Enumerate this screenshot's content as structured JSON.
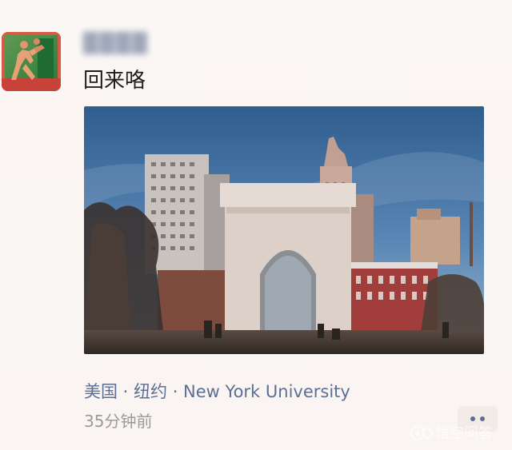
{
  "post": {
    "author_name": "████",
    "text": "回来咯",
    "location": "美国 · 纽约 · New York University",
    "time": "35分钟前"
  },
  "actions": {
    "more_label": "••"
  },
  "watermark": {
    "text": "悟空问答"
  },
  "colors": {
    "background": "#fbf6f4",
    "link_blue": "#5c6f93",
    "timestamp_gray": "#9a9a9a",
    "text_dark": "#1e1e1e"
  },
  "icons": {
    "avatar": "avatar-image",
    "more": "more-dots-icon",
    "watermark": "wukong-qa-logo"
  }
}
